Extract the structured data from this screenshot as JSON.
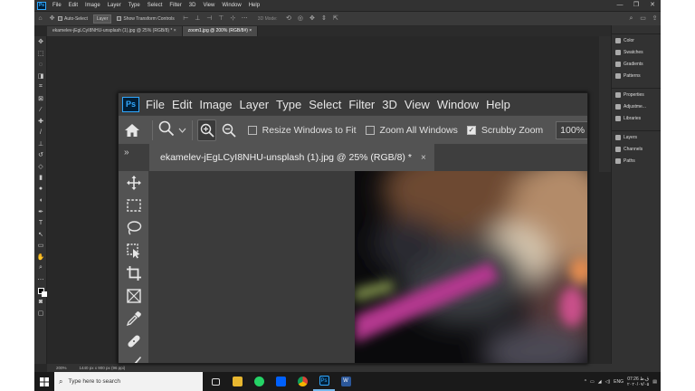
{
  "outer": {
    "app_icon": "Ps",
    "menu": [
      "File",
      "Edit",
      "Image",
      "Layer",
      "Type",
      "Select",
      "Filter",
      "3D",
      "View",
      "Window",
      "Help"
    ],
    "window_controls": [
      "—",
      "❐",
      "✕"
    ],
    "options": {
      "auto_select_label": "Auto-Select",
      "layer_dropdown": "Layer",
      "transform_label": "Show Transform Controls",
      "mode_label": "3D Mode:"
    },
    "tabs": [
      {
        "label": "ekamelev-jEgLCyI8NHU-unsplash (1).jpg @ 25% (RGB/8) *",
        "close": "×"
      },
      {
        "label": "zoom1.jpg @ 200% (RGB/8#)",
        "close": "×"
      }
    ],
    "status": {
      "zoom": "200%",
      "doc_size": "1440 px x 900 px (96 ppi)"
    },
    "panels": {
      "group1": [
        "Color",
        "Swatches",
        "Gradients",
        "Patterns"
      ],
      "group2": [
        "Properties",
        "Adjustme...",
        "Libraries"
      ],
      "group3": [
        "Layers",
        "Channels",
        "Paths"
      ]
    }
  },
  "zoomed": {
    "app_icon": "Ps",
    "menu": [
      "File",
      "Edit",
      "Image",
      "Layer",
      "Type",
      "Select",
      "Filter",
      "3D",
      "View",
      "Window",
      "Help"
    ],
    "options": {
      "resize_windows": "Resize Windows to Fit",
      "zoom_all": "Zoom All Windows",
      "scrubby_zoom": "Scrubby Zoom",
      "scrubby_checked": true,
      "percent": "100%"
    },
    "collapse_glyph": "»",
    "tab": {
      "label": "ekamelev-jEgLCyI8NHU-unsplash (1).jpg @ 25% (RGB/8) *",
      "close": "×"
    }
  },
  "taskbar": {
    "search_placeholder": "Type here to search",
    "apps": [
      "file-explorer",
      "whatsapp",
      "dropbox",
      "chrome",
      "photoshop",
      "word"
    ],
    "app_glyphs": {
      "photoshop": "Ps",
      "word": "W"
    },
    "language": "ENG",
    "time": "07:26 ق.ظ",
    "date": "۲۰۲۰/۰۷/۰۵"
  }
}
